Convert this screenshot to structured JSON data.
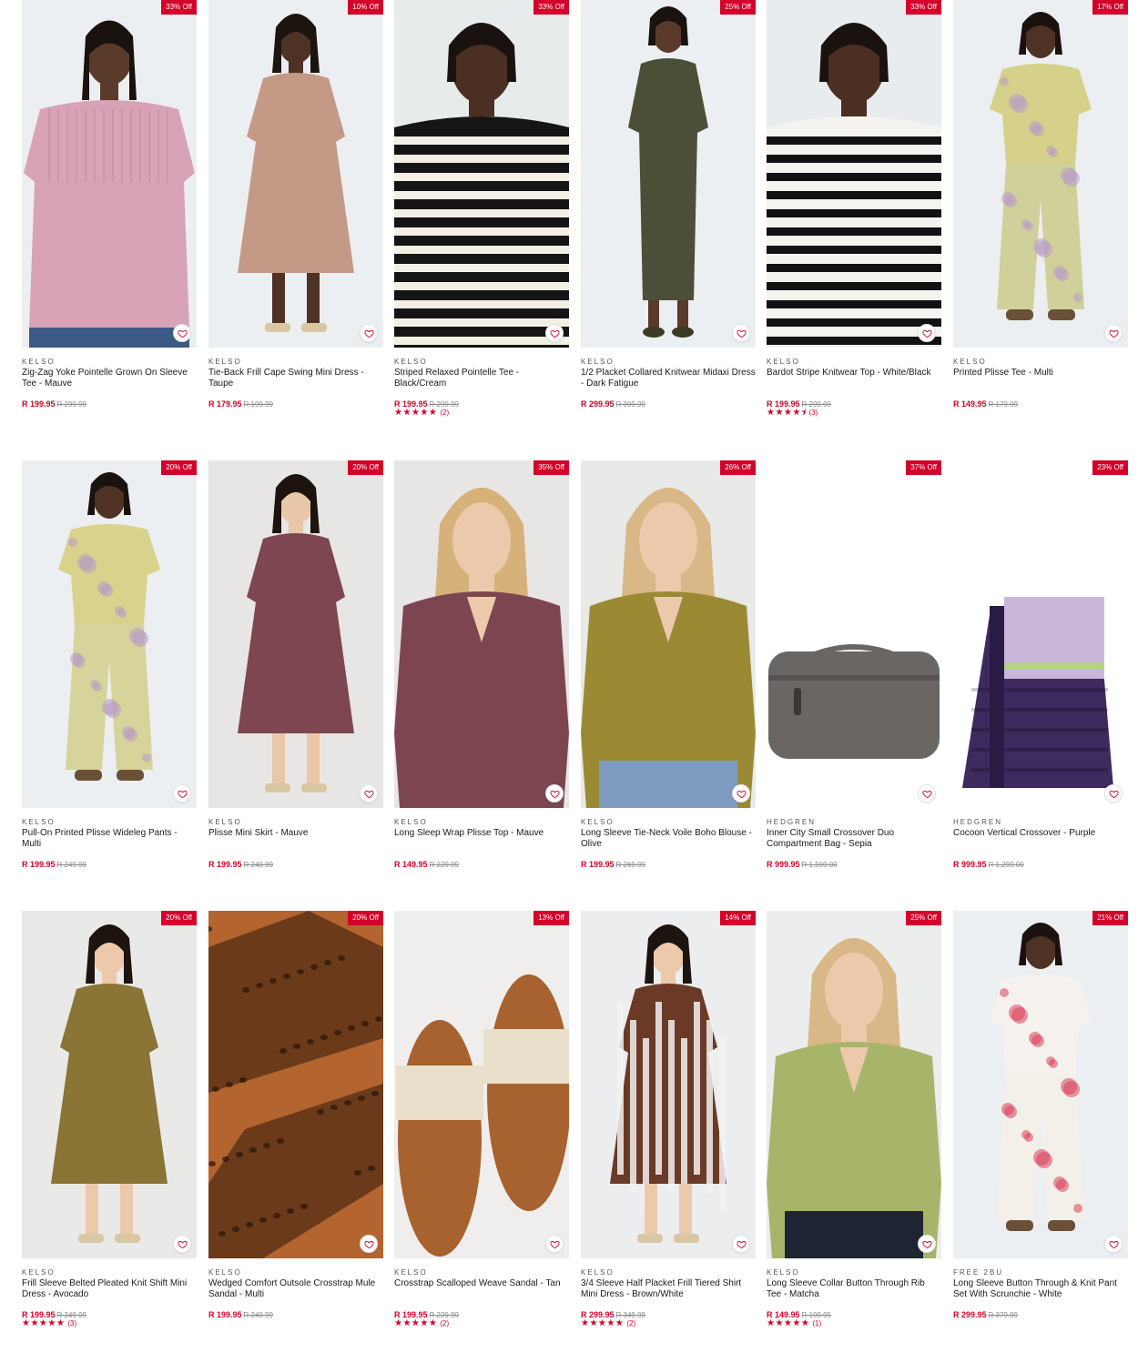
{
  "products": [
    {
      "badge": "33% Off",
      "brand": "KELSO",
      "title": "Zig-Zag Yoke Pointelle Grown On Sleeve Tee - Mauve",
      "price": "R 199.95",
      "was": "R 299.99",
      "stars": "",
      "reviews": "",
      "art": "model-top",
      "colors": {
        "bg": "#eceff1",
        "garment": "#d9a3b7",
        "skin": "#5a3a2a",
        "lower": "#3c5a86"
      }
    },
    {
      "badge": "10% Off",
      "brand": "KELSO",
      "title": "Tie-Back Frill Cape Swing Mini Dress - Taupe",
      "price": "R 179.95",
      "was": "R 199.99",
      "stars": "",
      "reviews": "",
      "art": "model-dress",
      "colors": {
        "bg": "#eceff1",
        "garment": "#c49a86",
        "skin": "#4e3224",
        "lower": "#4e3224"
      }
    },
    {
      "badge": "33% Off",
      "brand": "KELSO",
      "title": "Striped Relaxed Pointelle Tee - Black/Cream",
      "price": "R 199.95",
      "was": "R 299.99",
      "stars": "★★★★★",
      "reviews": "(2)",
      "art": "closeup-stripe",
      "colors": {
        "bg": "#e8ebec",
        "garment": "#151515",
        "stripe": "#f3efe4",
        "skin": "#4a2f22"
      }
    },
    {
      "badge": "25% Off",
      "brand": "KELSO",
      "title": "1/2 Placket Collared Knitwear Midaxi Dress - Dark Fatigue",
      "price": "R 299.95",
      "was": "R 399.99",
      "stars": "",
      "reviews": "",
      "art": "model-long",
      "colors": {
        "bg": "#eceff1",
        "garment": "#4c4f38",
        "skin": "#5a3a2a",
        "lower": "#4c4f38"
      }
    },
    {
      "badge": "33% Off",
      "brand": "KELSO",
      "title": "Bardot Stripe Knitwear Top - White/Black",
      "price": "R 199.95",
      "was": "R 299.99",
      "stars": "★★★★⯨",
      "reviews": "(3)",
      "art": "closeup-stripe",
      "colors": {
        "bg": "#e9ecee",
        "garment": "#f4f3ef",
        "stripe": "#121212",
        "skin": "#4a2f22"
      }
    },
    {
      "badge": "17% Off",
      "brand": "KELSO",
      "title": "Printed Plisse Tee - Multi",
      "price": "R 149.95",
      "was": "R 179.99",
      "stars": "",
      "reviews": "",
      "art": "model-set",
      "colors": {
        "bg": "#eceff1",
        "garment": "#d5d08a",
        "stripe": "#b99bc8",
        "skin": "#4e3224",
        "lower": "#cfd09a"
      }
    },
    {
      "badge": "20% Off",
      "brand": "KELSO",
      "title": "Pull-On Printed Plisse Wideleg Pants - Multi",
      "price": "R 199.95",
      "was": "R 249.99",
      "stars": "",
      "reviews": "",
      "art": "model-set",
      "colors": {
        "bg": "#eceff1",
        "garment": "#d8d28c",
        "stripe": "#b89ac6",
        "skin": "#4e3224",
        "lower": "#d6d49a"
      }
    },
    {
      "badge": "20% Off",
      "brand": "KELSO",
      "title": "Plisse Mini Skirt - Mauve",
      "price": "R 199.95",
      "was": "R 249.99",
      "stars": "",
      "reviews": "",
      "art": "model-dress",
      "colors": {
        "bg": "#e8e6e4",
        "garment": "#7e4650",
        "skin": "#e8c7a8",
        "lower": "#e8c7a8"
      }
    },
    {
      "badge": "35% Off",
      "brand": "KELSO",
      "title": "Long Sleep Wrap Plisse Top - Mauve",
      "price": "R 149.95",
      "was": "R 229.99",
      "stars": "",
      "reviews": "",
      "art": "closeup-top",
      "colors": {
        "bg": "#e8e6e4",
        "garment": "#7c4550",
        "skin": "#ecc9ab",
        "hair": "#d7b17a"
      }
    },
    {
      "badge": "26% Off",
      "brand": "KELSO",
      "title": "Long Sleeve Tie-Neck Voile Boho Blouse - Olive",
      "price": "R 199.95",
      "was": "R 269.99",
      "stars": "",
      "reviews": "",
      "art": "closeup-top",
      "colors": {
        "bg": "#e9e9e7",
        "garment": "#9a8a34",
        "skin": "#ecc9ab",
        "hair": "#d9b786",
        "lower": "#7f9bc0"
      }
    },
    {
      "badge": "37% Off",
      "brand": "HEDGREN",
      "title": "Inner City Small Crossover Duo Compartment Bag - Sepia",
      "price": "R 999.95",
      "was": "R 1,599.00",
      "stars": "",
      "reviews": "",
      "art": "bag-grey",
      "colors": {
        "bg": "#ffffff",
        "garment": "#6a6664"
      }
    },
    {
      "badge": "23% Off",
      "brand": "HEDGREN",
      "title": "Cocoon Vertical Crossover - Purple",
      "price": "R 999.95",
      "was": "R 1,299.00",
      "stars": "",
      "reviews": "",
      "art": "bag-purple",
      "colors": {
        "bg": "#ffffff",
        "garment": "#3d2a5e",
        "stripe": "#c9b7da"
      }
    },
    {
      "badge": "20% Off",
      "brand": "KELSO",
      "title": "Frill Sleeve Belted Pleated Knit Shift Mini Dress - Avocado",
      "price": "R 199.95",
      "was": "R 249.99",
      "stars": "★★★★★",
      "reviews": "(3)",
      "art": "model-dress",
      "colors": {
        "bg": "#e9e9e7",
        "garment": "#8a7436",
        "skin": "#ecc9ab",
        "lower": "#ecc9ab"
      }
    },
    {
      "badge": "20% Off",
      "brand": "KELSO",
      "title": "Wedged Comfort Outsole Crosstrap Mule Sandal - Multi",
      "price": "R 199.95",
      "was": "R 249.99",
      "stars": "",
      "reviews": "",
      "art": "sandal-leopard",
      "colors": {
        "bg": "#ece9e6",
        "garment": "#b4642f",
        "stripe": "#6b3a1a"
      }
    },
    {
      "badge": "13% Off",
      "brand": "KELSO",
      "title": "Crosstrap Scalloped Weave Sandal - Tan",
      "price": "R 199.95",
      "was": "R 229.99",
      "stars": "★★★★★",
      "reviews": "(2)",
      "art": "sandal-pair",
      "colors": {
        "bg": "#efeeec",
        "garment": "#a8622f",
        "stripe": "#eadfcb"
      }
    },
    {
      "badge": "14% Off",
      "brand": "KELSO",
      "title": "3/4 Sleeve Half Placket Frill Tiered Shirt Mini Dress - Brown/White",
      "price": "R 299.95",
      "was": "R 349.99",
      "stars": "★★★★★",
      "reviews": "(2)",
      "art": "model-dress",
      "colors": {
        "bg": "#ecedee",
        "garment": "#6a3a26",
        "stripe": "#f2f2f2",
        "skin": "#ecc9ab",
        "lower": "#ecc9ab"
      }
    },
    {
      "badge": "25% Off",
      "brand": "KELSO",
      "title": "Long Sleeve Collar Button Through Rib Tee - Matcha",
      "price": "R 149.95",
      "was": "R 199.95",
      "stars": "★★★★★",
      "reviews": "(1)",
      "art": "closeup-top",
      "colors": {
        "bg": "#eceded",
        "garment": "#a7b56a",
        "skin": "#ecc9ab",
        "hair": "#d9b786",
        "lower": "#1f2433"
      }
    },
    {
      "badge": "21% Off",
      "brand": "FREE 2BU",
      "title": "Long Sleeve Button Through & Knit Pant Set With Scrunchie - White",
      "price": "R 299.95",
      "was": "R 379.99",
      "stars": "",
      "reviews": "",
      "art": "model-set",
      "colors": {
        "bg": "#eceff1",
        "garment": "#f5f2ee",
        "stripe": "#d9415a",
        "skin": "#4e3224",
        "lower": "#f3f0ea"
      }
    }
  ]
}
